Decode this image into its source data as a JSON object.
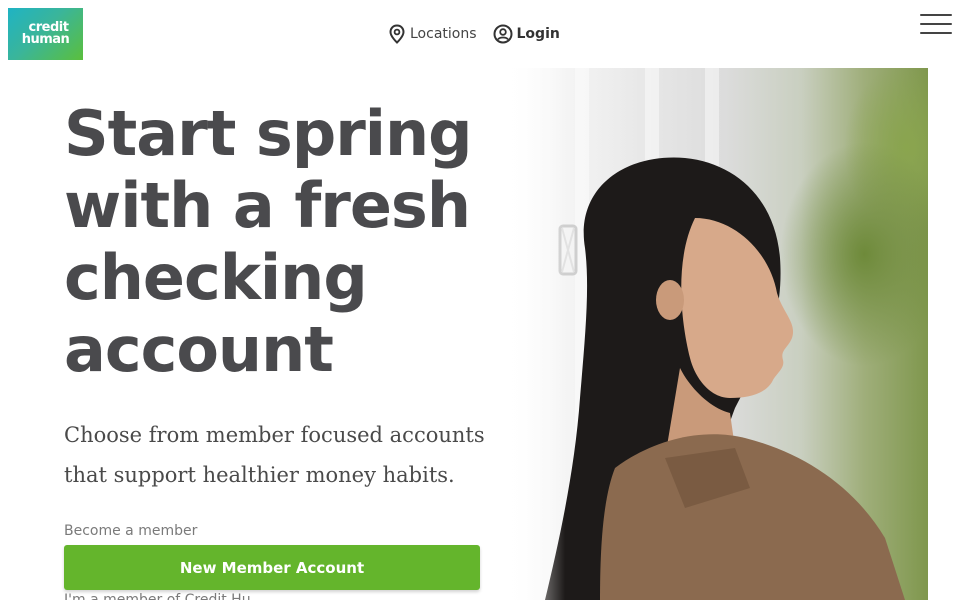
{
  "header": {
    "logo": {
      "line1": "credit",
      "line2": "human"
    },
    "nav": {
      "locations": {
        "label": "Locations",
        "icon": "map-pin-icon"
      },
      "login": {
        "label": "Login",
        "icon": "user-circle-icon"
      }
    },
    "menu_icon": "hamburger-menu-icon"
  },
  "hero": {
    "title": "Start spring with a fresh checking account",
    "subtitle": "Choose from member focused accounts that support healthier money habits.",
    "become_label": "Become a member",
    "cta_label": "New Member Account",
    "cut_off_text": "I'm a member of Credit Hu",
    "image_description_colors": {
      "accent_green": "#64b52c",
      "logo_gradient_start": "#1fb3c4",
      "logo_gradient_end": "#5bbf3c"
    }
  }
}
